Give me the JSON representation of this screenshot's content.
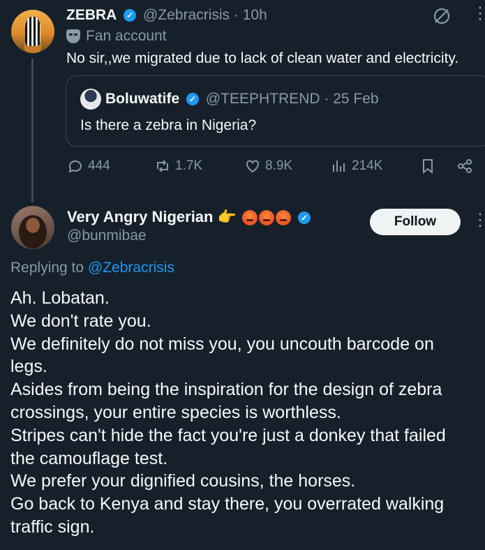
{
  "tweet": {
    "author_name": "ZEBRA",
    "author_handle": "@Zebracrisis",
    "time": "· 10h",
    "label": "Fan account",
    "text": "No sir,,we migrated due to lack of clean water and electricity.",
    "quote": {
      "author_name": "Boluwatife",
      "author_handle": "@TEEPHTREND",
      "time": "· 25 Feb",
      "text": "Is there a zebra in Nigeria?"
    },
    "stats": {
      "replies": "444",
      "reposts": "1.7K",
      "likes": "8.9K",
      "views": "214K"
    }
  },
  "reply": {
    "author_name": "Very Angry Nigerian",
    "author_handle": "@bunmibae",
    "follow_label": "Follow",
    "replying_prefix": "Replying to",
    "replying_handle": "@Zebracrisis",
    "lines": [
      "Ah. Lobatan.",
      "We don't rate you.",
      "We definitely do not miss you, you uncouth barcode on legs.",
      "Asides from being the inspiration for the design of zebra crossings, your entire species is worthless.",
      "Stripes can't hide the fact you're just a donkey that failed the camouflage test.",
      "We prefer your dignified cousins, the horses.",
      "Go back to Kenya and stay there, you overrated walking traffic sign."
    ]
  },
  "icons": {
    "verified": "verified-badge-icon",
    "mask": "theater-mask-icon",
    "grok": "grok-icon",
    "more": "more-options-icon",
    "reply": "reply-icon",
    "repost": "repost-icon",
    "like": "heart-icon",
    "views": "views-icon",
    "bookmark": "bookmark-icon",
    "share": "share-icon",
    "point": "pointing-right-emoji",
    "angry": "angry-face-emoji"
  },
  "colors": {
    "background": "#15202b",
    "accent": "#1d9bf0",
    "muted": "#8b98a5"
  }
}
